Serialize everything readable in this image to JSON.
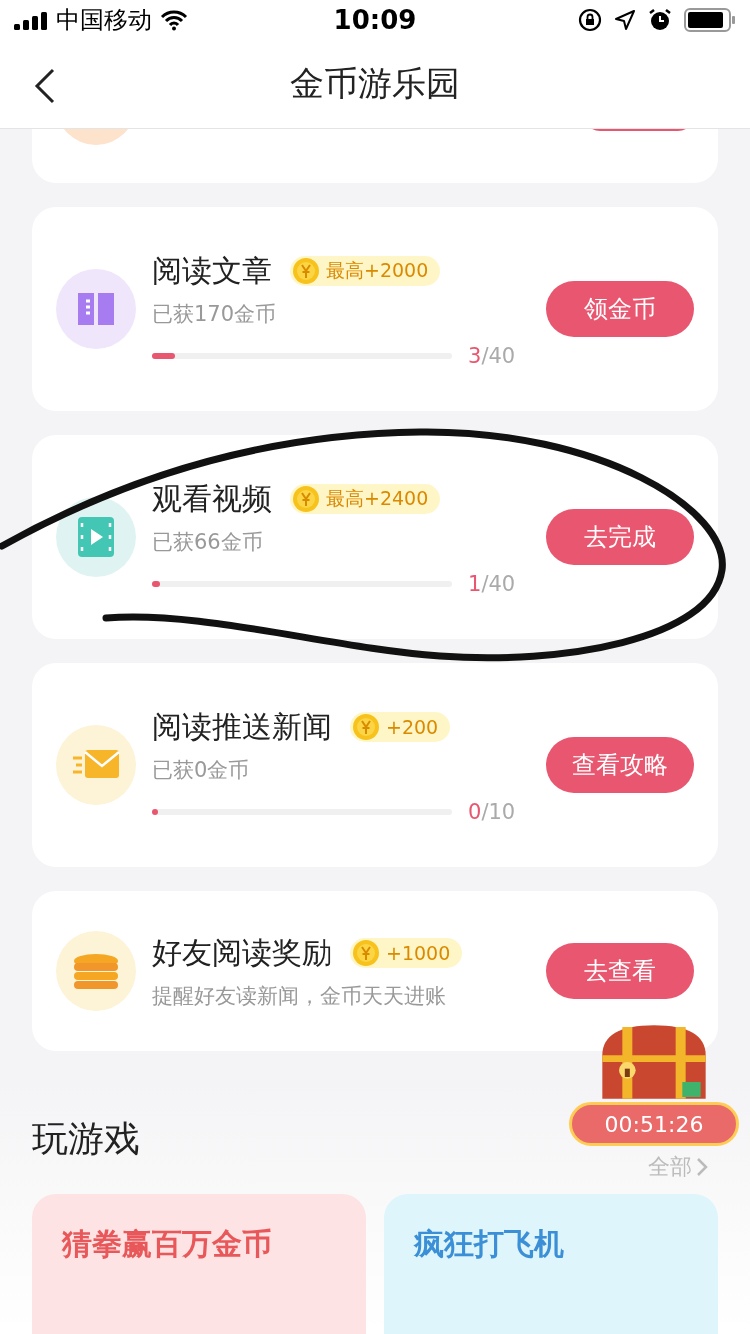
{
  "status_bar": {
    "carrier": "中国移动",
    "time": "10:09"
  },
  "nav": {
    "title": "金币游乐园"
  },
  "tasks": [
    {
      "kind": "progress",
      "title": "阅读文章",
      "reward": "最高+2000",
      "subtitle": "已获170金币",
      "level": 0.075,
      "done": "3",
      "total": "/40",
      "button": "领金币"
    },
    {
      "kind": "progress",
      "title": "观看视频",
      "reward": "最高+2400",
      "subtitle": "已获66金币",
      "level": 0.025,
      "done": "1",
      "total": "/40",
      "button": "去完成"
    },
    {
      "kind": "progress",
      "title": "阅读推送新闻",
      "reward": "+200",
      "subtitle": "已获0金币",
      "level": 0,
      "done": "0",
      "total": "/10",
      "button": "查看攻略"
    },
    {
      "kind": "plain",
      "title": "好友阅读奖励",
      "reward": "+1000",
      "subtitle": "提醒好友读新闻，金币天天进账",
      "button": "去查看"
    }
  ],
  "chest": {
    "timer": "00:51:26"
  },
  "games": {
    "title": "玩游戏",
    "more": "全部",
    "items": [
      {
        "title": "猜拳赢百万金币",
        "color": "#fde3e3"
      },
      {
        "title": "疯狂打飞机",
        "color": "#def5fb"
      }
    ]
  }
}
